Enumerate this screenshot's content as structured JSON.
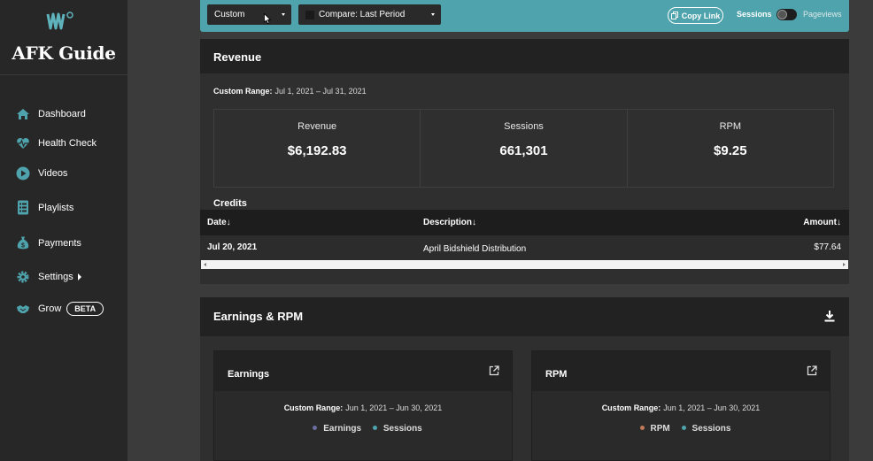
{
  "sidebar": {
    "brand": "AFK Guide",
    "items": [
      {
        "label": "Dashboard"
      },
      {
        "label": "Health Check"
      },
      {
        "label": "Videos"
      },
      {
        "label": "Playlists"
      },
      {
        "label": "Payments"
      },
      {
        "label": "Settings"
      },
      {
        "label": "Grow",
        "badge": "BETA"
      }
    ]
  },
  "topbar": {
    "date_select": "Custom",
    "compare_select": "Compare: Last Period",
    "copy_link": "Copy Link",
    "toggle_left": "Sessions",
    "toggle_right": "Pageviews"
  },
  "revenue": {
    "title": "Revenue",
    "range_label": "Custom Range:",
    "range_value": "Jul 1, 2021 – Jul 31, 2021",
    "stats": [
      {
        "label": "Revenue",
        "value": "$6,192.83"
      },
      {
        "label": "Sessions",
        "value": "661,301"
      },
      {
        "label": "RPM",
        "value": "$9.25"
      }
    ],
    "credits": {
      "title": "Credits",
      "columns": [
        "Date↓",
        "Description↓",
        "Amount↓"
      ],
      "rows": [
        {
          "date": "Jul 20, 2021",
          "description": "April Bidshield Distribution",
          "amount": "$77.64"
        }
      ]
    }
  },
  "earnings_rpm": {
    "title": "Earnings & RPM",
    "panels": [
      {
        "title": "Earnings",
        "range_label": "Custom Range:",
        "range_value": "Jun 1, 2021 – Jun 30, 2021",
        "legend": [
          "Earnings",
          "Sessions"
        ]
      },
      {
        "title": "RPM",
        "range_label": "Custom Range:",
        "range_value": "Jun 1, 2021 – Jun 30, 2021",
        "legend": [
          "RPM",
          "Sessions"
        ]
      }
    ]
  },
  "colors": {
    "accent": "#4fa3ad",
    "earnings_dot": "#6a6fa0",
    "sessions_dot": "#4fa3ad",
    "rpm_dot": "#c07a5a"
  }
}
